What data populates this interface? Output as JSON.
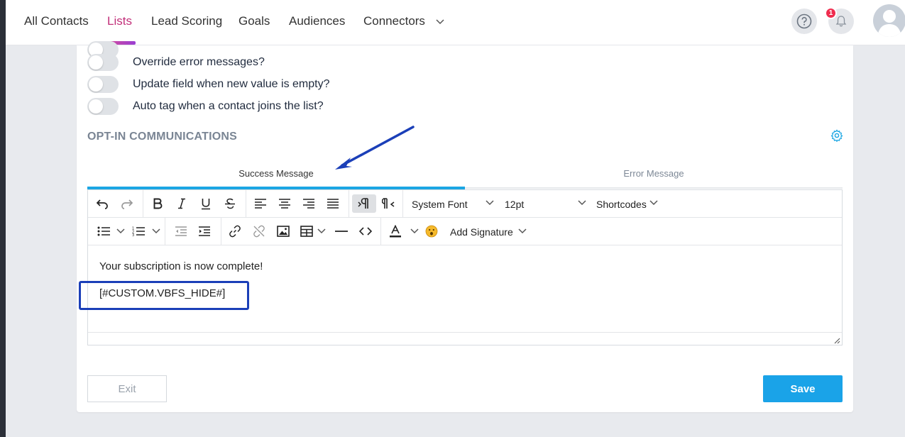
{
  "nav": {
    "items": [
      {
        "label": "All Contacts"
      },
      {
        "label": "Lists"
      },
      {
        "label": "Lead Scoring"
      },
      {
        "label": "Goals"
      },
      {
        "label": "Audiences"
      },
      {
        "label": "Connectors"
      }
    ],
    "notification_count": "1"
  },
  "settings": {
    "toggles": [
      {
        "label": "Override error messages?"
      },
      {
        "label": "Update field when new value is empty?"
      },
      {
        "label": "Auto tag when a contact joins the list?"
      }
    ],
    "section_title": "OPT-IN COMMUNICATIONS"
  },
  "tabs": [
    {
      "label": "Success Message"
    },
    {
      "label": "Error Message"
    }
  ],
  "editor": {
    "font_family": "System Font",
    "font_size": "12pt",
    "shortcodes_label": "Shortcodes",
    "add_signature_label": "Add Signature",
    "content_lines": [
      "Your subscription is now complete!",
      "[#CUSTOM.VBFS_HIDE#]"
    ]
  },
  "actions": {
    "exit_label": "Exit",
    "save_label": "Save"
  },
  "colors": {
    "accent": "#1aa3e8",
    "active_nav": "#c2307a",
    "annotation": "#1b3fb8"
  }
}
